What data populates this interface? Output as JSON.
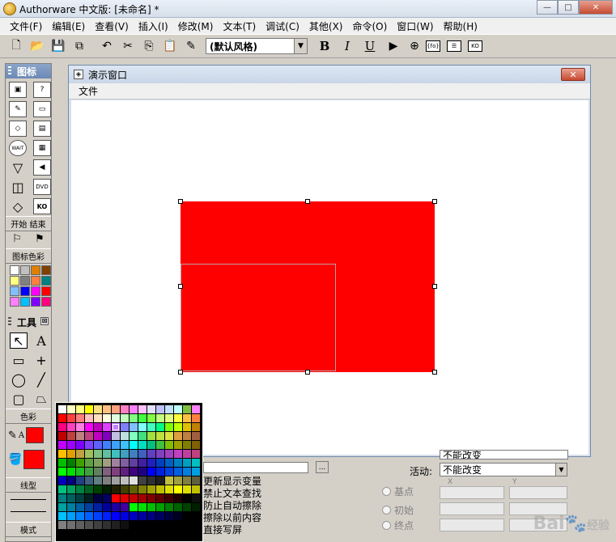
{
  "app": {
    "title": "Authorware 中文版: [未命名] *",
    "window_buttons": {
      "minimize": "—",
      "maximize": "□",
      "close": "✕"
    }
  },
  "menubar": [
    {
      "label": "文件(F)"
    },
    {
      "label": "编辑(E)"
    },
    {
      "label": "查看(V)"
    },
    {
      "label": "插入(I)"
    },
    {
      "label": "修改(M)"
    },
    {
      "label": "文本(T)"
    },
    {
      "label": "调试(C)"
    },
    {
      "label": "其他(X)"
    },
    {
      "label": "命令(O)"
    },
    {
      "label": "窗口(W)"
    },
    {
      "label": "帮助(H)"
    }
  ],
  "toolbar": {
    "style_select": "(默认风格)",
    "bold": "B",
    "italic": "I",
    "underline": "U",
    "func_label": "{fo}",
    "ko_label": "KO"
  },
  "palette": {
    "icons_title": "图标",
    "icon_labels": {
      "wait": "WAIT",
      "dvd": "DVD",
      "ko": "KO"
    },
    "start_end": "开始 结束",
    "icon_color_label": "图标色彩",
    "icon_colors": [
      "#ffffff",
      "#c0c0c0",
      "#e08000",
      "#804000",
      "#ffff80",
      "#808080",
      "#ff8040",
      "#008080",
      "#80c0ff",
      "#0000ff",
      "#ff00ff",
      "#ff0000",
      "#ff80ff",
      "#00c0ff",
      "#8000ff",
      "#ff0080"
    ],
    "tools_title": "工具",
    "tools_text_tool": "A",
    "color_label": "色彩",
    "color_swatch_letter": "A",
    "line_label": "线型",
    "mode_label": "模式"
  },
  "color_popup": {
    "colors": [
      "#ffffff",
      "#ffffc0",
      "#ffff80",
      "#ffff00",
      "#ffe080",
      "#ffc080",
      "#ffa080",
      "#ff80c0",
      "#ff80ff",
      "#ffc0ff",
      "#e0e0ff",
      "#c0c0ff",
      "#c0e0ff",
      "#c0ffff",
      "#80c040",
      "#ff80ff",
      "#ff0000",
      "#ff4040",
      "#ff8080",
      "#ffc0c0",
      "#ffe0c0",
      "#ffffe0",
      "#e0ffe0",
      "#c0ffc0",
      "#80ff80",
      "#40ff40",
      "#80ff40",
      "#c0ff80",
      "#e0ff80",
      "#ffff40",
      "#ffc040",
      "#ff8040",
      "#ff0080",
      "#ff40c0",
      "#ff80e0",
      "#ff00ff",
      "#c000c0",
      "#e040ff",
      "#c080ff",
      "#8080ff",
      "#80c0ff",
      "#80ffff",
      "#40ffc0",
      "#00ff80",
      "#80ff00",
      "#c0ff00",
      "#e0c000",
      "#c08000",
      "#c00000",
      "#c04040",
      "#c08080",
      "#c04080",
      "#c000c0",
      "#8000c0",
      "#c0c0e0",
      "#c0e0e0",
      "#80ffc0",
      "#40e080",
      "#a0e040",
      "#c0e040",
      "#e0e040",
      "#e0a040",
      "#c08040",
      "#a06040",
      "#c000ff",
      "#a000ff",
      "#8000ff",
      "#8040ff",
      "#6060ff",
      "#4080ff",
      "#40a0ff",
      "#40c0ff",
      "#00ffff",
      "#00e0c0",
      "#00c080",
      "#40c040",
      "#80c000",
      "#a0a000",
      "#808000",
      "#806000",
      "#ffc000",
      "#e0a000",
      "#c0a040",
      "#a0c060",
      "#80c080",
      "#60c0a0",
      "#40c0c0",
      "#40a0c0",
      "#4080c0",
      "#4060c0",
      "#6040c0",
      "#8040c0",
      "#a040c0",
      "#c040c0",
      "#c040a0",
      "#c04080",
      "#00c000",
      "#008000",
      "#40a000",
      "#60a040",
      "#80a060",
      "#a0a080",
      "#a080a0",
      "#8060a0",
      "#6040a0",
      "#4020a0",
      "#2020c0",
      "#0040c0",
      "#0060c0",
      "#0080c0",
      "#00a0c0",
      "#00c0c0",
      "#00ff00",
      "#00e000",
      "#20c020",
      "#40a040",
      "#608060",
      "#806080",
      "#804080",
      "#602080",
      "#400080",
      "#200080",
      "#0000ff",
      "#0020e0",
      "#0040e0",
      "#0060e0",
      "#0080e0",
      "#00a0e0",
      "#0000c0",
      "#000080",
      "#204080",
      "#406080",
      "#608080",
      "#808080",
      "#a0a0a0",
      "#c0c0c0",
      "#e0e0e0",
      "#404040",
      "#303030",
      "#202020",
      "#c0c040",
      "#a0a040",
      "#808040",
      "#606040",
      "#00c080",
      "#00a060",
      "#008040",
      "#006020",
      "#004000",
      "#002000",
      "#202000",
      "#404000",
      "#606000",
      "#808000",
      "#a0a000",
      "#c0c000",
      "#e0e000",
      "#ffff00",
      "#e0e000",
      "#c0c000",
      "#008080",
      "#006060",
      "#004040",
      "#002020",
      "#000040",
      "#000060",
      "#ff0000",
      "#e00000",
      "#c00000",
      "#a00000",
      "#800000",
      "#600000",
      "#400000",
      "#200000",
      "#000000",
      "#101010",
      "#00a0a0",
      "#0080a0",
      "#0060a0",
      "#0040a0",
      "#0020a0",
      "#0000a0",
      "#2000a0",
      "#4000a0",
      "#00ff00",
      "#00e000",
      "#00c000",
      "#00a000",
      "#008000",
      "#006000",
      "#004000",
      "#002000",
      "#00c0ff",
      "#00a0ff",
      "#0080ff",
      "#0060ff",
      "#0040ff",
      "#0020ff",
      "#0000ff",
      "#0000e0",
      "#0000c0",
      "#0000a0",
      "#000080",
      "#000060",
      "#000040",
      "#000020",
      "#000000",
      "#000000",
      "#808080",
      "#707070",
      "#606060",
      "#505050",
      "#404040",
      "#303030",
      "#202020",
      "#101010",
      "#000000",
      "#000000",
      "#000000",
      "#000000",
      "#000000",
      "#000000",
      "#000000",
      "#000000"
    ]
  },
  "presentation": {
    "title": "演示窗口",
    "close": "✕",
    "menu_file": "文件",
    "fill_color": "#ff0000"
  },
  "properties": {
    "options": [
      "更新显示变量",
      "禁止文本查找",
      "防止自动擦除",
      "擦除以前内容",
      "直接写屏"
    ],
    "active_label": "活动:",
    "active_value": "不能改变",
    "radios": [
      "基点",
      "初始",
      "终点"
    ],
    "axis_x": "X",
    "axis_y": "Y",
    "ellipsis": "...",
    "truncated_value": "不能改变"
  },
  "watermark": {
    "brand": "Bai",
    "paw": "🐾",
    "suffix": "经验"
  }
}
